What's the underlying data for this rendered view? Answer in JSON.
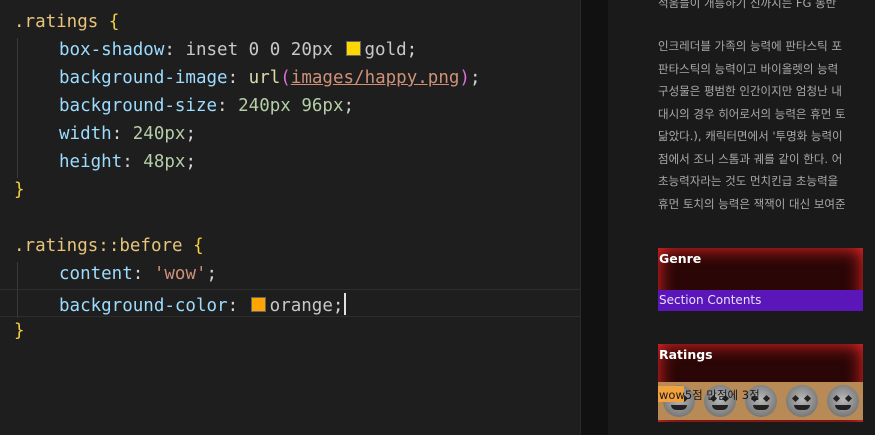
{
  "editor": {
    "lines": [
      {
        "selector": ".ratings",
        "brace_open": "{"
      },
      {
        "prop": "box-shadow",
        "value_pre": "inset 0 0 20px",
        "swatch": "#ffd700",
        "value_post": "gold"
      },
      {
        "prop": "background-image",
        "fn": "url",
        "url": "images/happy.png"
      },
      {
        "prop": "background-size",
        "value": "240px 96px"
      },
      {
        "prop": "width",
        "value": "240px"
      },
      {
        "prop": "height",
        "value": "48px"
      },
      {
        "brace_close": "}"
      },
      {
        "selector": ".ratings::before",
        "brace_open": "{"
      },
      {
        "prop": "content",
        "value": "'wow'"
      },
      {
        "prop": "background-color",
        "swatch": "#ffa500",
        "value_post": "orange"
      },
      {
        "brace_close": "}"
      }
    ]
  },
  "preview": {
    "top_text": "석움들이 개릉하기 신까지는 FG 동반",
    "paragraph": [
      "인크레더블 가족의 능력에 판타스틱 포",
      "판타스틱의 능력이고 바이올렛의 능력",
      "구성물은 평범한 인간이지만 엄청난 내",
      "대시의 경우 히어로서의 능력은 휴먼 토",
      "닮았다.), 캐릭터면에서 '투명화 능력이",
      "점에서 조니 스톰과 궤를 같이 한다. 어",
      "초능력자라는 것도 먼치킨급 초능력을",
      "휴먼 토치의 능력은 잭잭이 대신 보여준"
    ],
    "genre_title": "Genre",
    "genre_section": "Section Contents",
    "ratings_title": "Ratings",
    "ratings_text": "wow5점 만점에 3점"
  },
  "colors": {
    "gold": "#ffd700",
    "orange": "#ffa500",
    "genre_section_bg": "#5a16b8",
    "box_glow": "#ff2a2a"
  }
}
